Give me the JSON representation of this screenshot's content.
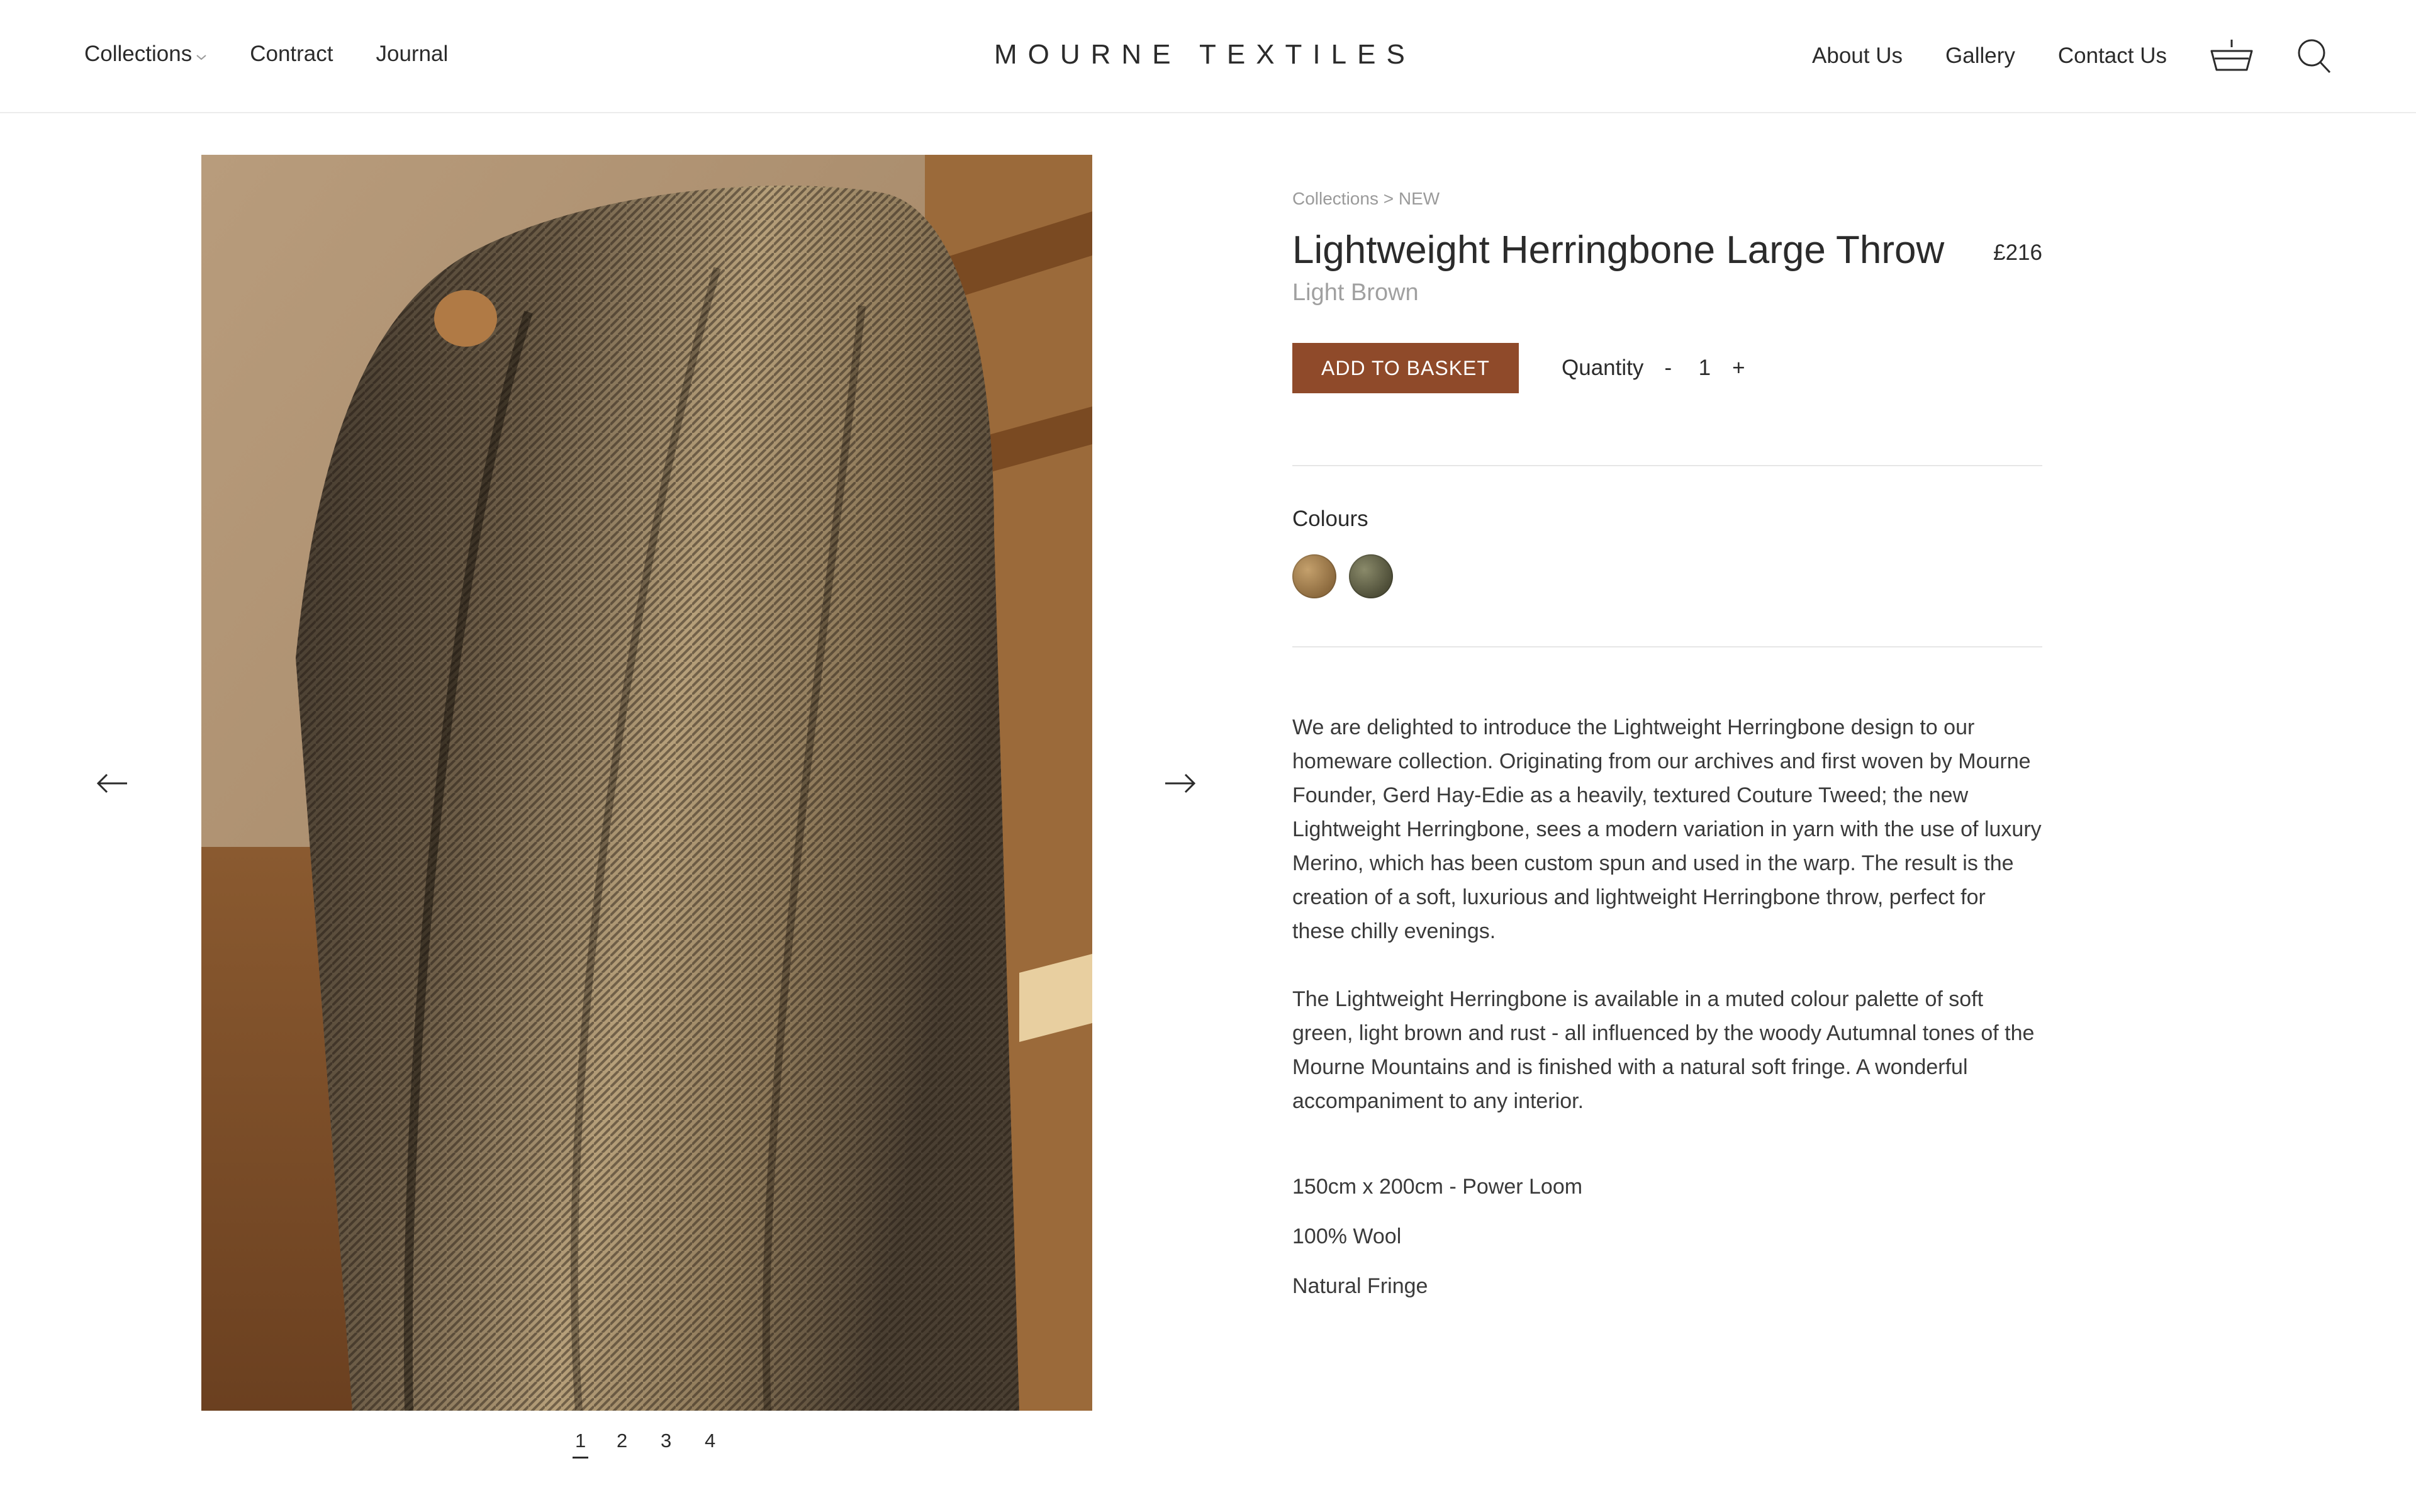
{
  "header": {
    "brand": "MOURNE TEXTILES",
    "nav_left": [
      "Collections",
      "Contract",
      "Journal"
    ],
    "nav_right": [
      "About Us",
      "Gallery",
      "Contact Us"
    ],
    "icons": [
      "basket-icon",
      "search-icon"
    ]
  },
  "gallery": {
    "pages": [
      "1",
      "2",
      "3",
      "4"
    ],
    "active_page": "1",
    "icons": [
      "arrow-left-icon",
      "arrow-right-icon"
    ]
  },
  "product": {
    "breadcrumb": "Collections > NEW",
    "title": "Lightweight Herringbone Large Throw",
    "price": "£216",
    "colour_name": "Light Brown",
    "add_button": "ADD TO BASKET",
    "quantity_label": "Quantity",
    "quantity_minus": "-",
    "quantity_value": "1",
    "quantity_plus": "+",
    "colours_label": "Colours",
    "swatch_colors": [
      "#a9824f",
      "#6b6b4e"
    ],
    "description": [
      "We are delighted to introduce the Lightweight Herringbone design to our homeware collection. Originating from our archives and first woven by Mourne Founder, Gerd Hay-Edie as a heavily, textured Couture Tweed; the new Lightweight Herringbone, sees a modern variation in yarn with the use of luxury Merino, which has been custom spun and used in the warp. The result is the creation of a soft, luxurious and lightweight Herringbone throw, perfect for these chilly evenings.",
      "The Lightweight Herringbone is available in a muted colour palette of soft green, light brown and rust - all influenced by the woody Autumnal tones of the Mourne Mountains and is finished with a natural soft fringe. A wonderful accompaniment to any interior."
    ],
    "specs": [
      "150cm x 200cm - Power Loom",
      "100% Wool",
      "Natural Fringe"
    ]
  },
  "colors": {
    "accent": "#8f4a2a",
    "text": "#2b2b2b",
    "muted": "#a0a0a0"
  }
}
